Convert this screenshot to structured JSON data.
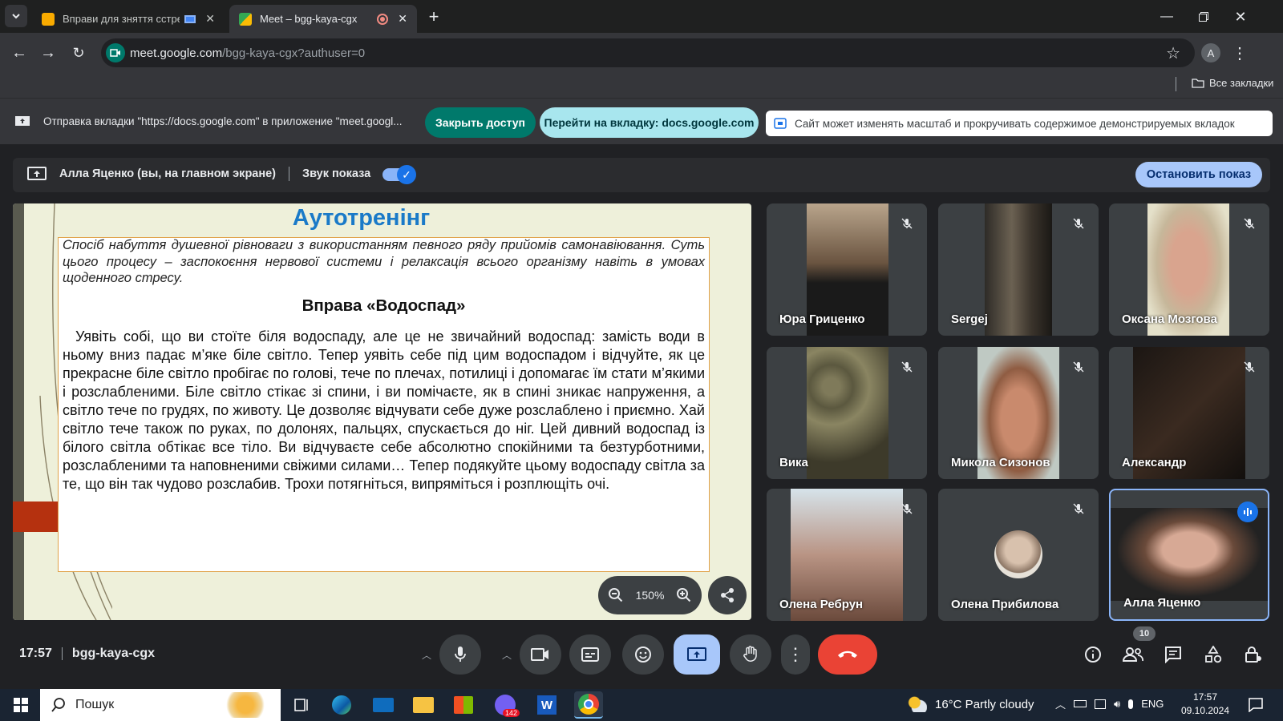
{
  "browser": {
    "tabs": [
      {
        "title": "Вправи для зняття сстресу"
      },
      {
        "title": "Meet – bgg-kaya-cgx"
      }
    ],
    "url": {
      "host": "meet.google.com",
      "path": "/bgg-kaya-cgx?authuser=0"
    },
    "profile_initial": "A",
    "bookmarks_label": "Все закладки"
  },
  "share_notice": {
    "message": "Отправка вкладки \"https://docs.google.com\" в приложение \"meet.googl...",
    "stop_access": "Закрыть доступ",
    "goto_tab": "Перейти на вкладку: docs.google.com",
    "scroll_notice": "Сайт может изменять масштаб и прокручивать содержимое демонстрируемых вкладок"
  },
  "meet": {
    "presenter_label": "Алла Яценко (вы, на главном экране)",
    "sound_label": "Звук показа",
    "stop_button": "Остановить показ",
    "zoom": "150%",
    "time": "17:57",
    "meeting_code": "bgg-kaya-cgx",
    "participants_count": "10",
    "participants": [
      {
        "name": "Юра Гриценко",
        "muted": true
      },
      {
        "name": "Sergej",
        "muted": true
      },
      {
        "name": "Оксана Мозгова",
        "muted": true
      },
      {
        "name": "Вика",
        "muted": true
      },
      {
        "name": "Микола Сизонов",
        "muted": true
      },
      {
        "name": "Александр",
        "muted": true
      },
      {
        "name": "Олена Ребрун",
        "muted": true
      },
      {
        "name": "Олена Прибилова",
        "muted": true
      },
      {
        "name": "Алла Яценко",
        "muted": false
      }
    ]
  },
  "slide": {
    "title": "Аутотренінг",
    "definition": "Спосіб набуття душевної рівноваги з використанням певного ряду прийомів самонавіювання. Суть цього процесу – заспокоєння нервової системи і релаксація всього організму навіть в умовах щоденного стресу.",
    "exercise_title": "Вправа «Водоспад»",
    "body": "Уявіть собі, що ви стоїте біля водоспаду, але це не звичайний водоспад: замість води в ньому вниз падає м’яке біле світло. Тепер уявіть себе під цим водоспадом і відчуйте, як це прекрасне біле світло пробігає по голові, тече по плечах, потилиці і допомагає їм стати м’якими і розслабленими. Біле світло стікає зі спини, і ви помічаєте, як в спині зникає напруження, а світло тече по грудях, по животу. Це дозволяє відчувати себе дуже розслаблено і приємно. Хай світло тече також по руках, по долонях, пальцях, спускається до ніг. Цей дивний водоспад із білого світла обтікає все тіло. Ви відчуваєте себе абсолютно спокійними та безтурботними, розслабленими та наповненими свіжими силами… Тепер подякуйте цьому водоспаду світла за те, що він так чудово розслабив. Трохи потягніться, випряміться і розплющіть очі."
  },
  "taskbar": {
    "search_placeholder": "Пошук",
    "weather": "16°C  Partly cloudy",
    "language": "ENG",
    "time": "17:57",
    "date": "09.10.2024",
    "viber_badge": "142"
  },
  "colors": {
    "accent": "#8ab4f8",
    "slide_title": "#1a7ac8",
    "hangup": "#ea4335",
    "chip": "#00796b"
  }
}
